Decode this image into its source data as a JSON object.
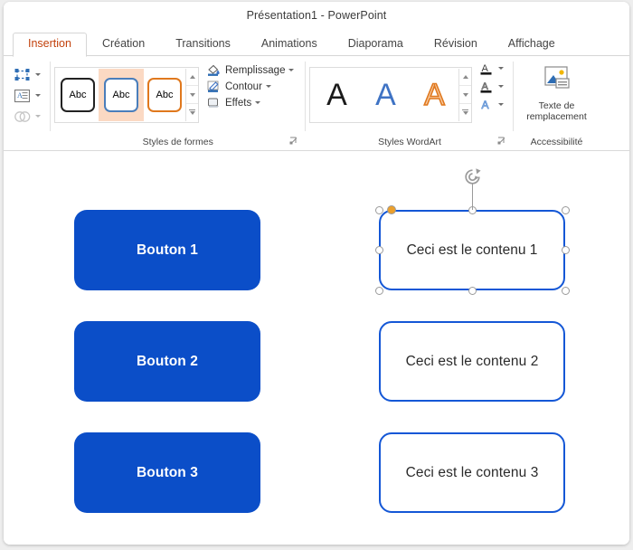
{
  "window": {
    "title": "Présentation1  -  PowerPoint"
  },
  "tabs": [
    {
      "label": "Insertion",
      "active": true
    },
    {
      "label": "Création",
      "active": false
    },
    {
      "label": "Transitions",
      "active": false
    },
    {
      "label": "Animations",
      "active": false
    },
    {
      "label": "Diaporama",
      "active": false
    },
    {
      "label": "Révision",
      "active": false
    },
    {
      "label": "Affichage",
      "active": false
    }
  ],
  "ribbon": {
    "mini_tools": [
      {
        "icon": "arrange-shapes-icon",
        "has_caret": true,
        "enabled": true
      },
      {
        "icon": "text-box-icon",
        "has_caret": true,
        "enabled": true
      },
      {
        "icon": "merge-shapes-icon",
        "has_caret": true,
        "enabled": false
      }
    ],
    "shape_styles": {
      "label": "Styles de formes",
      "swatches": [
        {
          "text": "Abc",
          "border": "#222222",
          "selected": false
        },
        {
          "text": "Abc",
          "border": "#4a7ebb",
          "selected": true
        },
        {
          "text": "Abc",
          "border": "#E0781D",
          "selected": false
        }
      ],
      "scroll_up": "scroll-up-icon",
      "scroll_down": "scroll-down-icon",
      "more": "more-styles-icon",
      "launcher": "dialog-launcher-icon"
    },
    "shape_format": [
      {
        "label": "Remplissage",
        "icon": "fill-bucket-icon",
        "caret": true
      },
      {
        "label": "Contour",
        "icon": "outline-pen-icon",
        "caret": true
      },
      {
        "label": "Effets",
        "icon": "shape-effects-icon",
        "caret": true
      }
    ],
    "wordart_styles": {
      "label": "Styles WordArt",
      "swatches": [
        {
          "glyph": "A",
          "style": "filled-black",
          "color": "#1b1b1b"
        },
        {
          "glyph": "A",
          "style": "filled-blue",
          "color": "#3F73C4"
        },
        {
          "glyph": "A",
          "style": "outline-orange",
          "color": "#E0781D"
        }
      ],
      "scroll_up": "scroll-up-icon",
      "scroll_down": "scroll-down-icon",
      "more": "more-styles-icon",
      "small_tools": [
        {
          "icon": "text-fill-icon",
          "caret": true
        },
        {
          "icon": "text-outline-icon",
          "caret": true
        },
        {
          "icon": "text-effects-icon",
          "caret": true
        }
      ],
      "launcher": "dialog-launcher-icon"
    },
    "accessibility": {
      "label": "Accessibilité",
      "button_label": "Texte de remplacement",
      "icon": "alt-text-picture-icon"
    }
  },
  "canvas": {
    "buttons": [
      {
        "label": "Bouton 1"
      },
      {
        "label": "Bouton 2"
      },
      {
        "label": "Bouton 3"
      }
    ],
    "content_shapes": [
      {
        "label": "Ceci est le contenu 1",
        "selected": true
      },
      {
        "label": "Ceci est le contenu 2",
        "selected": false
      },
      {
        "label": "Ceci est le contenu 3",
        "selected": false
      }
    ],
    "selection": {
      "rotate_handle": "rotate-handle-icon",
      "adjust_handle": "adjust-corner-handle"
    }
  },
  "colors": {
    "accent_blue": "#0B4EC8",
    "outline_blue": "#1457D6",
    "active_tab_text": "#c2410c",
    "selected_swatch_bg": "#fbd9c3",
    "adjust_handle": "#ECA02C"
  }
}
